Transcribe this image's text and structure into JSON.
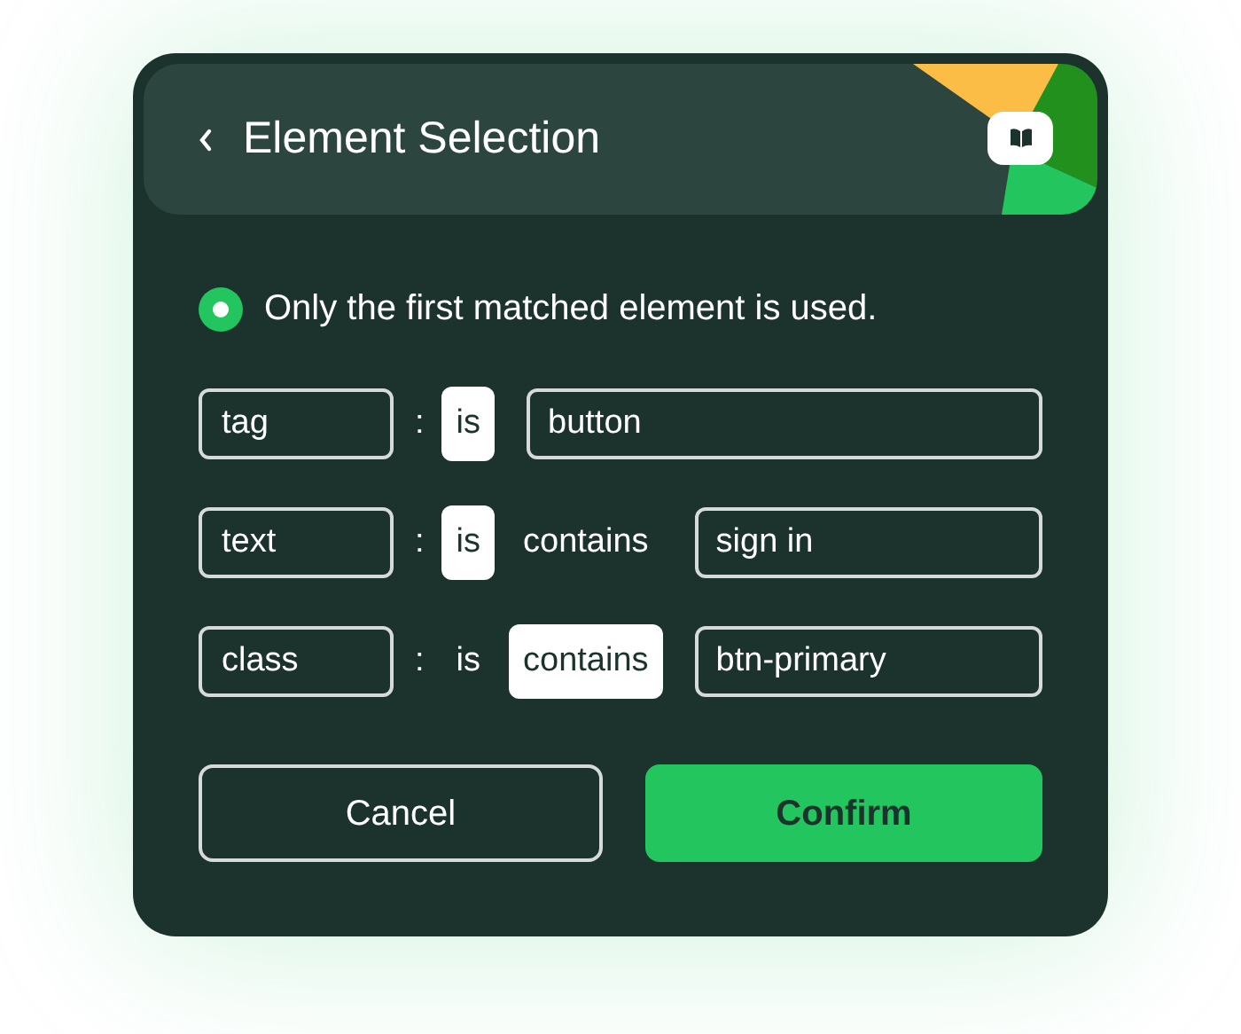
{
  "header": {
    "title": "Element Selection"
  },
  "notice": {
    "selected": true,
    "text": "Only the first matched element is used."
  },
  "rules": [
    {
      "attribute": "tag",
      "separator": ":",
      "operators": [
        {
          "label": "is",
          "selected": true
        }
      ],
      "value": "button"
    },
    {
      "attribute": "text",
      "separator": ":",
      "operators": [
        {
          "label": "is",
          "selected": true
        },
        {
          "label": "contains",
          "selected": false
        }
      ],
      "value": "sign in"
    },
    {
      "attribute": "class",
      "separator": ":",
      "operators": [
        {
          "label": "is",
          "selected": false
        },
        {
          "label": "contains",
          "selected": true
        }
      ],
      "value": "btn-primary"
    }
  ],
  "buttons": [
    {
      "label": "Cancel",
      "kind": "secondary"
    },
    {
      "label": "Confirm",
      "kind": "primary"
    }
  ]
}
